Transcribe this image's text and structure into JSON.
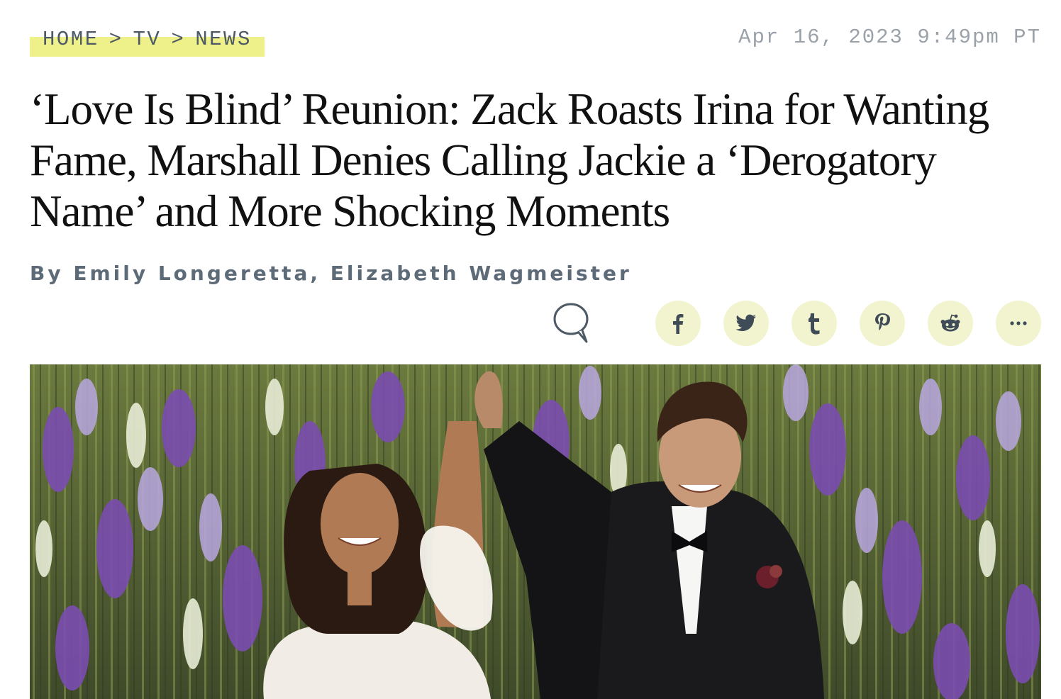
{
  "breadcrumb": {
    "items": [
      {
        "label": "HOME"
      },
      {
        "label": "TV"
      },
      {
        "label": "NEWS"
      }
    ],
    "separator": ">"
  },
  "timestamp": "Apr 16, 2023 9:49pm PT",
  "headline": "‘Love Is Blind’ Reunion: Zack Roasts Irina for Wanting Fame, Marshall Denies Calling Jackie a ‘Derogatory Name’ and More Shocking Moments",
  "byline": {
    "prefix": "By",
    "authors": [
      {
        "name": "Emily Longeretta"
      },
      {
        "name": "Elizabeth Wagmeister"
      }
    ],
    "joiner": ","
  },
  "share": {
    "comment_icon": "speech-bubble-icon",
    "buttons": [
      {
        "id": "facebook",
        "icon": "facebook-icon"
      },
      {
        "id": "twitter",
        "icon": "twitter-icon"
      },
      {
        "id": "tumblr",
        "icon": "tumblr-icon"
      },
      {
        "id": "pinterest",
        "icon": "pinterest-icon"
      },
      {
        "id": "reddit",
        "icon": "reddit-icon"
      },
      {
        "id": "more",
        "icon": "more-icon"
      }
    ],
    "button_bg": "#f2f3cf",
    "icon_color": "#3f4c57"
  },
  "colors": {
    "breadcrumb_highlight": "#eef08a",
    "meta_text": "#4d5a66",
    "timestamp_text": "#9aa1a8",
    "headline_text": "#111111"
  }
}
